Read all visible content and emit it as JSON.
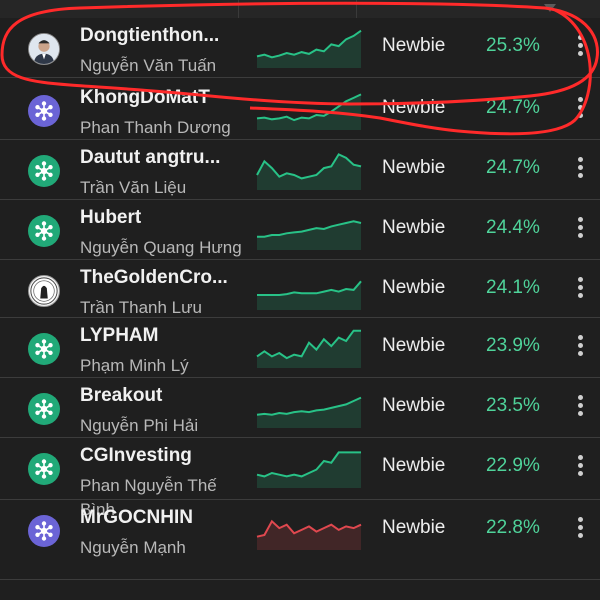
{
  "columns": {
    "level_sort_icon": "caret-down-icon"
  },
  "rows": [
    {
      "username": "Dongtienthon...",
      "fullname": "Nguyễn Văn Tuấn",
      "level": "Newbie",
      "return": "25.3%",
      "avatar": "photo",
      "spark_color": "#28c287",
      "spark": [
        10,
        12,
        9,
        11,
        14,
        12,
        15,
        13,
        18,
        16,
        24,
        22,
        30,
        34,
        40
      ]
    },
    {
      "username": "KhongDoMatT",
      "fullname": "Phan Thanh Dương",
      "level": "Newbie",
      "return": "24.7%",
      "avatar": "purple",
      "spark_color": "#28c287",
      "spark": [
        10,
        11,
        9,
        10,
        12,
        8,
        11,
        10,
        14,
        13,
        18,
        24,
        30,
        34,
        38
      ]
    },
    {
      "username": "Dautut angtru...",
      "fullname": "Trần Văn Liệu",
      "level": "Newbie",
      "return": "24.7%",
      "avatar": "green",
      "spark_color": "#28c287",
      "spark": [
        14,
        30,
        22,
        12,
        16,
        14,
        10,
        12,
        14,
        22,
        24,
        38,
        34,
        26,
        24
      ]
    },
    {
      "username": "Hubert",
      "fullname": "Nguyễn Quang Hưng",
      "level": "Newbie",
      "return": "24.4%",
      "avatar": "green",
      "spark_color": "#28c287",
      "spark": [
        12,
        12,
        14,
        14,
        16,
        17,
        18,
        20,
        22,
        21,
        24,
        26,
        28,
        30,
        28
      ]
    },
    {
      "username": "TheGoldenCro...",
      "fullname": "Trần Thanh Lưu",
      "level": "Newbie",
      "return": "24.1%",
      "avatar": "coin",
      "spark_color": "#28c287",
      "spark": [
        14,
        14,
        14,
        14,
        15,
        17,
        16,
        16,
        16,
        18,
        20,
        18,
        21,
        20,
        30
      ]
    },
    {
      "username": "LYPHAM",
      "fullname": "Phạm Minh Lý",
      "level": "Newbie",
      "return": "23.9%",
      "avatar": "green",
      "spark_color": "#28c287",
      "spark": [
        10,
        16,
        10,
        14,
        8,
        12,
        10,
        26,
        18,
        30,
        22,
        32,
        28,
        40,
        40
      ]
    },
    {
      "username": "Breakout",
      "fullname": "Nguyễn Phi Hải",
      "level": "Newbie",
      "return": "23.5%",
      "avatar": "green",
      "spark_color": "#28c287",
      "spark": [
        12,
        13,
        12,
        14,
        13,
        15,
        16,
        15,
        17,
        18,
        20,
        22,
        24,
        28,
        32
      ]
    },
    {
      "username": "CGInvesting",
      "fullname": "Phan Nguyễn Thế Bình",
      "level": "Newbie",
      "return": "22.9%",
      "avatar": "green",
      "spark_color": "#28c287",
      "spark": [
        12,
        10,
        14,
        12,
        10,
        12,
        10,
        14,
        18,
        28,
        26,
        38,
        38,
        38,
        38
      ]
    },
    {
      "username": "MrGOCNHIN",
      "fullname": "Nguyễn Mạnh",
      "level": "Newbie",
      "return": "22.8%",
      "avatar": "purple",
      "spark_color": "#e0484f",
      "spark": [
        12,
        14,
        30,
        22,
        26,
        16,
        20,
        24,
        18,
        22,
        26,
        20,
        24,
        22,
        26
      ]
    }
  ]
}
